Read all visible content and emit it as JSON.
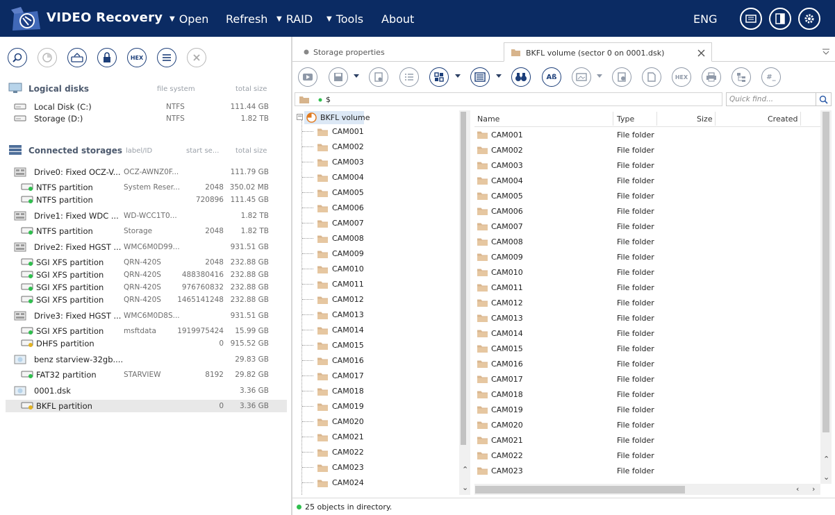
{
  "app": {
    "title": "VIDEO Recovery",
    "menu": [
      {
        "label": "Open",
        "has_caret": true
      },
      {
        "label": "Refresh",
        "has_caret": false
      },
      {
        "label": "RAID",
        "has_caret": true
      },
      {
        "label": "Tools",
        "has_caret": true
      },
      {
        "label": "About",
        "has_caret": false
      }
    ],
    "language": "ENG",
    "accent_color": "#0b2b63"
  },
  "left_toolbar": {
    "hex_label": "HEX",
    "buttons": [
      "zoom-search-icon",
      "pie-chart-icon",
      "disk-image-icon",
      "lock-icon",
      "hex-icon",
      "list-icon",
      "close-icon"
    ]
  },
  "logical_disks": {
    "title": "Logical disks",
    "col_fs": "file system",
    "col_size": "total size",
    "items": [
      {
        "name": "Local Disk (C:)",
        "fs": "NTFS",
        "size": "111.44 GB"
      },
      {
        "name": "Storage (D:)",
        "fs": "NTFS",
        "size": "1.82 TB"
      }
    ]
  },
  "connected_storages": {
    "title": "Connected storages",
    "col_label": "label/ID",
    "col_start": "start se...",
    "col_size": "total size",
    "items": [
      {
        "name": "Drive0: Fixed OCZ-V...",
        "label": "OCZ-AWNZ0F...",
        "start": "",
        "size": "111.79 GB",
        "level": 0,
        "kind": "drive"
      },
      {
        "name": "NTFS partition",
        "label": "System Reser...",
        "start": "2048",
        "size": "350.02 MB",
        "level": 1,
        "kind": "part"
      },
      {
        "name": "NTFS partition",
        "label": "",
        "start": "720896",
        "size": "111.45 GB",
        "level": 1,
        "kind": "part"
      },
      {
        "name": "Drive1: Fixed WDC ...",
        "label": "WD-WCC1T0...",
        "start": "",
        "size": "1.82 TB",
        "level": 0,
        "kind": "drive"
      },
      {
        "name": "NTFS partition",
        "label": "Storage",
        "start": "2048",
        "size": "1.82 TB",
        "level": 1,
        "kind": "part"
      },
      {
        "name": "Drive2: Fixed HGST ...",
        "label": "WMC6M0D99...",
        "start": "",
        "size": "931.51 GB",
        "level": 0,
        "kind": "drive"
      },
      {
        "name": "SGI XFS partition",
        "label": "QRN-420S",
        "start": "2048",
        "size": "232.88 GB",
        "level": 1,
        "kind": "part"
      },
      {
        "name": "SGI XFS partition",
        "label": "QRN-420S",
        "start": "488380416",
        "size": "232.88 GB",
        "level": 1,
        "kind": "part"
      },
      {
        "name": "SGI XFS partition",
        "label": "QRN-420S",
        "start": "976760832",
        "size": "232.88 GB",
        "level": 1,
        "kind": "part"
      },
      {
        "name": "SGI XFS partition",
        "label": "QRN-420S",
        "start": "1465141248",
        "size": "232.88 GB",
        "level": 1,
        "kind": "part"
      },
      {
        "name": "Drive3: Fixed HGST ...",
        "label": "WMC6M0D8S...",
        "start": "",
        "size": "931.51 GB",
        "level": 0,
        "kind": "drive"
      },
      {
        "name": "SGI XFS partition",
        "label": "msftdata",
        "start": "1919975424",
        "size": "15.99 GB",
        "level": 1,
        "kind": "part"
      },
      {
        "name": "DHFS partition",
        "label": "",
        "start": "0",
        "size": "915.52 GB",
        "level": 1,
        "kind": "part-warn"
      },
      {
        "name": "benz starview-32gb....",
        "label": "",
        "start": "",
        "size": "29.83 GB",
        "level": 0,
        "kind": "image"
      },
      {
        "name": "FAT32 partition",
        "label": "STARVIEW",
        "start": "8192",
        "size": "29.82 GB",
        "level": 1,
        "kind": "part"
      },
      {
        "name": "0001.dsk",
        "label": "",
        "start": "",
        "size": "3.36 GB",
        "level": 0,
        "kind": "image"
      },
      {
        "name": "BKFL partition",
        "label": "",
        "start": "0",
        "size": "3.36 GB",
        "level": 1,
        "kind": "part-warn",
        "selected": true
      }
    ]
  },
  "tabs": [
    {
      "label": "Storage properties",
      "active": false
    },
    {
      "label": "BKFL volume (sector 0 on 0001.dsk)",
      "active": true
    }
  ],
  "path": "$",
  "quick_find": {
    "placeholder": "Quick find..."
  },
  "tree": {
    "root": "BKFL volume",
    "items": [
      "CAM001",
      "CAM002",
      "CAM003",
      "CAM004",
      "CAM005",
      "CAM006",
      "CAM007",
      "CAM008",
      "CAM009",
      "CAM010",
      "CAM011",
      "CAM012",
      "CAM013",
      "CAM014",
      "CAM015",
      "CAM016",
      "CAM017",
      "CAM018",
      "CAM019",
      "CAM020",
      "CAM021",
      "CAM022",
      "CAM023",
      "CAM024"
    ]
  },
  "list": {
    "columns": {
      "name": "Name",
      "type": "Type",
      "size": "Size",
      "created": "Created"
    },
    "rows": [
      {
        "name": "CAM001",
        "type": "File folder"
      },
      {
        "name": "CAM002",
        "type": "File folder"
      },
      {
        "name": "CAM003",
        "type": "File folder"
      },
      {
        "name": "CAM004",
        "type": "File folder"
      },
      {
        "name": "CAM005",
        "type": "File folder"
      },
      {
        "name": "CAM006",
        "type": "File folder"
      },
      {
        "name": "CAM007",
        "type": "File folder"
      },
      {
        "name": "CAM008",
        "type": "File folder"
      },
      {
        "name": "CAM009",
        "type": "File folder"
      },
      {
        "name": "CAM010",
        "type": "File folder"
      },
      {
        "name": "CAM011",
        "type": "File folder"
      },
      {
        "name": "CAM012",
        "type": "File folder"
      },
      {
        "name": "CAM013",
        "type": "File folder"
      },
      {
        "name": "CAM014",
        "type": "File folder"
      },
      {
        "name": "CAM015",
        "type": "File folder"
      },
      {
        "name": "CAM016",
        "type": "File folder"
      },
      {
        "name": "CAM017",
        "type": "File folder"
      },
      {
        "name": "CAM018",
        "type": "File folder"
      },
      {
        "name": "CAM019",
        "type": "File folder"
      },
      {
        "name": "CAM020",
        "type": "File folder"
      },
      {
        "name": "CAM021",
        "type": "File folder"
      },
      {
        "name": "CAM022",
        "type": "File folder"
      },
      {
        "name": "CAM023",
        "type": "File folder"
      }
    ]
  },
  "status": {
    "text": "25 objects in directory."
  },
  "right_toolbar": {
    "hex_label": "HEX",
    "text_label": "Aß",
    "hash_label": "#_"
  }
}
